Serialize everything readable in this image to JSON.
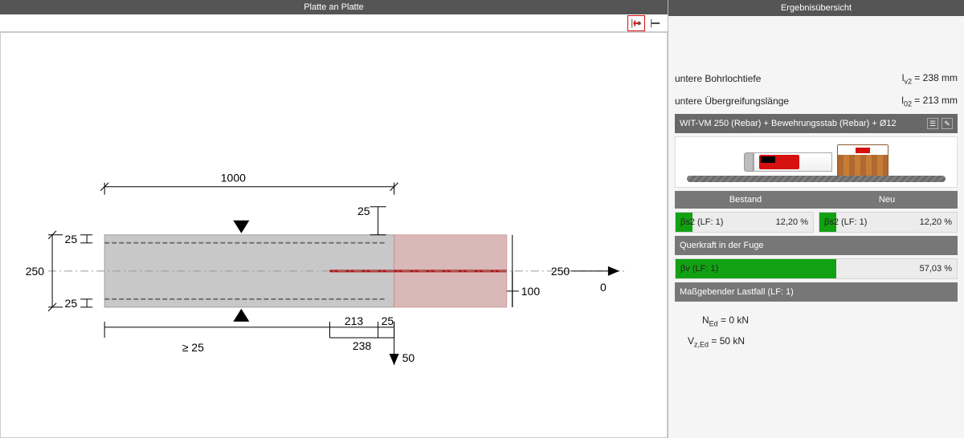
{
  "left": {
    "title": "Platte an Platte",
    "dim_top_width": "1000",
    "dim_top_cover": "25",
    "dim_side_height": "250",
    "dim_side_top_cover": "25",
    "dim_side_bot_cover": "25",
    "dim_right_height": "250",
    "dim_right_new_thickness": "100",
    "dim_right_axial": "0",
    "dim_bot_l0": "213",
    "dim_bot_cover_v": "25",
    "dim_bot_lv": "238",
    "dim_bot_min": "≥ 25",
    "dim_shear_force": "50"
  },
  "right": {
    "title": "Ergebnisübersicht",
    "row1_label": "untere Bohrlochtiefe",
    "row1_sym_prefix": "l",
    "row1_sym_sub": "v2",
    "row1_val": " = 238 mm",
    "row2_label": "untere Übergreifungslänge",
    "row2_sym_prefix": "l",
    "row2_sym_sub": "02",
    "row2_val": " = 213 mm",
    "product_line": "WIT-VM 250 (Rebar) + Bewehrungsstab (Rebar) + Ø12",
    "col_existing": "Bestand",
    "col_new": "Neu",
    "pair": {
      "name_existing": "βs2 (LF: 1)",
      "val_existing": "12,20 %",
      "pct_existing": 12.2,
      "name_new": "βs2 (LF: 1)",
      "val_new": "12,20 %",
      "pct_new": 12.2
    },
    "shear_header": "Querkraft in der Fuge",
    "shear_name": "βv (LF: 1)",
    "shear_val": "57,03 %",
    "shear_pct": 57.03,
    "governing": "Maßgebender Lastfall (LF: 1)",
    "n_prefix": "N",
    "n_sub": "Ed",
    "n_val": " = 0 kN",
    "v_prefix": "V",
    "v_sub": "z,Ed",
    "v_val": " = 50 kN"
  }
}
